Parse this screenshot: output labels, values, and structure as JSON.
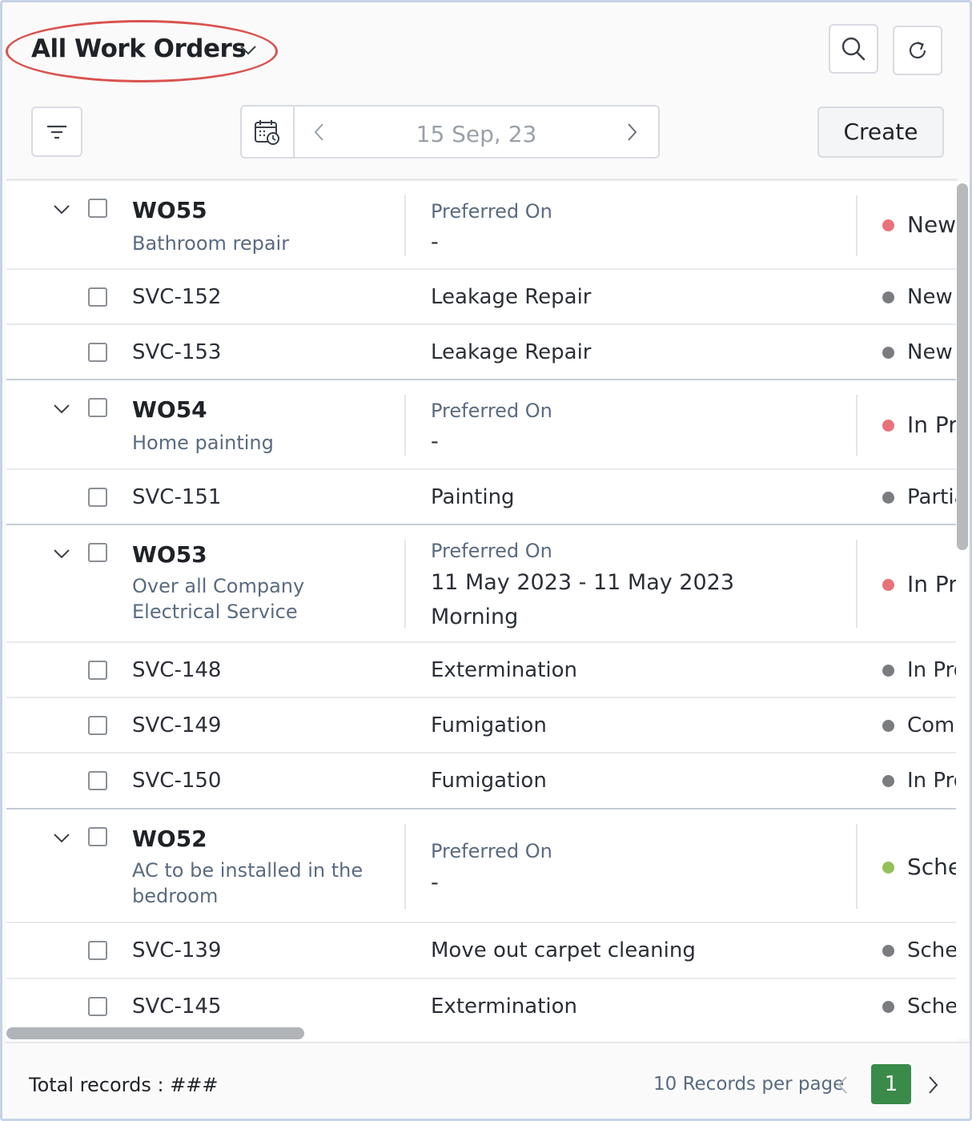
{
  "header": {
    "title": "All Work Orders"
  },
  "toolbar": {
    "date": "15 Sep, 23",
    "create_label": "Create"
  },
  "labels": {
    "preferred_on": "Preferred On"
  },
  "rows": [
    {
      "kind": "wo",
      "id": "WO55",
      "subject": "Bathroom repair",
      "preferred": "-",
      "preferred2": "",
      "status": "New",
      "status_color": "#e8727a"
    },
    {
      "kind": "svc",
      "id": "SVC-152",
      "desc": "Leakage Repair",
      "status": "New",
      "status_color": "#7a7c80"
    },
    {
      "kind": "svc",
      "id": "SVC-153",
      "desc": "Leakage Repair",
      "status": "New",
      "status_color": "#7a7c80"
    },
    {
      "kind": "wo",
      "id": "WO54",
      "subject": "Home painting",
      "preferred": "-",
      "preferred2": "",
      "status": "In Pr",
      "status_color": "#e8727a"
    },
    {
      "kind": "svc",
      "id": "SVC-151",
      "desc": "Painting",
      "status": "Partia",
      "status_color": "#7a7c80"
    },
    {
      "kind": "wo",
      "id": "WO53",
      "subject": "Over all Company Electrical Service",
      "preferred": "11 May 2023 - 11 May 2023",
      "preferred2": "Morning",
      "status": "In Pr",
      "status_color": "#e8727a"
    },
    {
      "kind": "svc",
      "id": "SVC-148",
      "desc": "Extermination",
      "status": "In Pro",
      "status_color": "#7a7c80"
    },
    {
      "kind": "svc",
      "id": "SVC-149",
      "desc": "Fumigation",
      "status": "Comp",
      "status_color": "#7a7c80"
    },
    {
      "kind": "svc",
      "id": "SVC-150",
      "desc": "Fumigation",
      "status": "In Pro",
      "status_color": "#7a7c80"
    },
    {
      "kind": "wo",
      "id": "WO52",
      "subject": "AC to be installed in the bedroom",
      "preferred": "-",
      "preferred2": "",
      "status": "Sche",
      "status_color": "#94bf5a"
    },
    {
      "kind": "svc",
      "id": "SVC-139",
      "desc": "Move out carpet cleaning",
      "status": "Schec",
      "status_color": "#7a7c80"
    },
    {
      "kind": "svc",
      "id": "SVC-145",
      "desc": "Extermination",
      "status": "Schec",
      "status_color": "#7a7c80"
    }
  ],
  "footer": {
    "total": "Total records : ###",
    "per_page": "10 Records per page",
    "page": "1"
  },
  "icons": [
    "chevron-down-icon",
    "search-icon",
    "refresh-icon",
    "filter-icon",
    "calendar-clock-icon",
    "chevron-left-icon",
    "chevron-right-icon"
  ]
}
